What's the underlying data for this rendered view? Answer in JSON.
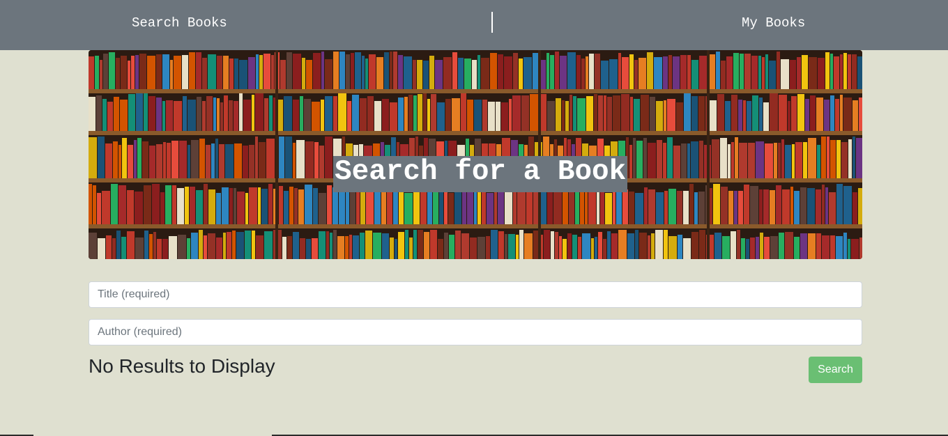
{
  "nav": {
    "search_books": "Search Books",
    "my_books": "My Books"
  },
  "hero": {
    "title": "Search for a Book"
  },
  "form": {
    "title_placeholder": "Title (required)",
    "author_placeholder": "Author (required)",
    "title_value": "",
    "author_value": ""
  },
  "results": {
    "heading": "No Results to Display"
  },
  "buttons": {
    "search_label": "Search"
  },
  "colors": {
    "navbar": "#6c757d",
    "page_background": "#dfe0d0",
    "search_button": "#6abf73"
  }
}
